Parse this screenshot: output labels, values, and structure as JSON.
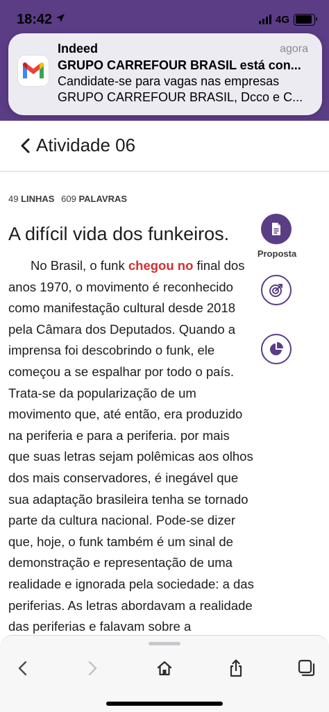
{
  "status_bar": {
    "time": "18:42",
    "network": "4G",
    "battery_level": 0.9,
    "icons": [
      "location-arrow-icon",
      "signal-icon",
      "battery-icon"
    ]
  },
  "notification": {
    "app": "Indeed",
    "time": "agora",
    "title": "GRUPO CARREFOUR BRASIL está con...",
    "body_line1": "Candidate-se para vagas nas empresas",
    "body_line2": "GRUPO CARREFOUR BRASIL, Dcco e C...",
    "icon": "gmail-icon"
  },
  "header": {
    "title": "Atividade 06",
    "back_icon": "chevron-left-icon"
  },
  "stats": {
    "lines_value": "49",
    "lines_label": "LINHAS",
    "words_value": "609",
    "words_label": "PALAVRAS"
  },
  "essay": {
    "title": "A difícil vida dos funkeiros.",
    "before": "No Brasil, o funk ",
    "highlight": "chegou no",
    "after": " final dos anos 1970, o movimento é reconhecido como manifestação cultural desde 2018 pela Câmara dos Deputados. Quando a imprensa foi descobrindo o funk, ele começou a se espalhar por todo o país. Trata-se da popularização de um movimento que, até então, era produzido na periferia e para a periferia. por mais que suas letras sejam polêmicas aos olhos dos mais conservadores, é inegável que sua adaptação brasileira tenha se tornado parte da cultura nacional. Pode-se dizer que, hoje, o funk também é um sinal de demonstração e representação de uma realidade e ignorada pela sociedade: a das periferias. As letras abordavam a realidade das periferias e falavam sobre a"
  },
  "tools": {
    "proposta_label": "Proposta",
    "icons": [
      "document-icon",
      "target-icon",
      "pie-chart-icon"
    ]
  },
  "colors": {
    "brand_purple": "#5b3d86",
    "highlight_red": "#d12f2f"
  },
  "browser_bar": {
    "icons": [
      "back-arrow-icon",
      "forward-arrow-icon",
      "home-icon",
      "share-icon",
      "tabs-icon"
    ]
  }
}
